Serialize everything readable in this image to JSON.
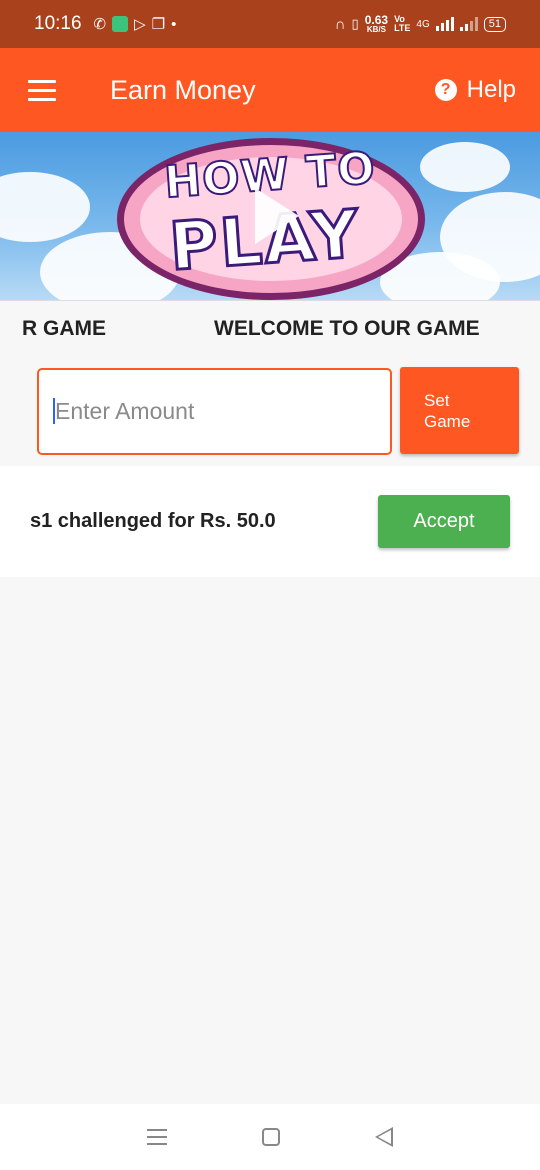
{
  "status_bar": {
    "time": "10:16",
    "net_speed_value": "0.63",
    "net_speed_unit": "KB/S",
    "volte_top": "Vo",
    "volte_bottom": "LTE",
    "network_type": "4G",
    "battery": "51",
    "icons": [
      "whatsapp-icon",
      "messages-icon",
      "play-store-icon",
      "copy-icon",
      "dot-icon",
      "headphones-icon",
      "vibrate-icon"
    ]
  },
  "toolbar": {
    "title": "Earn Money",
    "help_label": "Help",
    "background": "#ff5722"
  },
  "banner": {
    "line1": "HOW TO",
    "line2": "PLAY"
  },
  "marquee": {
    "left_fragment": "R GAME",
    "text": "WELCOME TO OUR GAME"
  },
  "amount_form": {
    "placeholder": "Enter Amount",
    "set_label_line1": "Set",
    "set_label_line2": "Game"
  },
  "challenges": [
    {
      "text": "s1 challenged for Rs. 50.0",
      "accept_label": "Accept"
    }
  ],
  "colors": {
    "accent": "#ff5722",
    "status_bar": "#a8411c",
    "accept": "#4caf50"
  }
}
